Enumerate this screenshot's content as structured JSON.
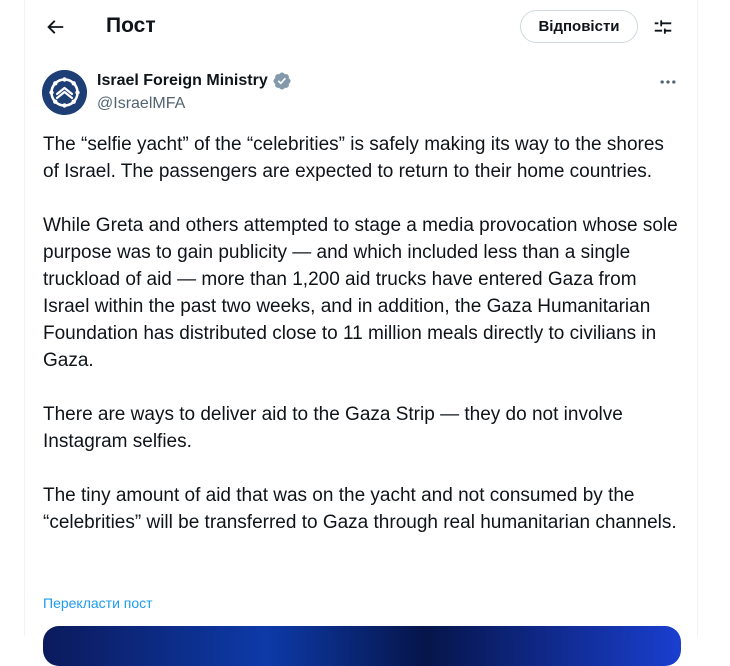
{
  "header": {
    "title": "Пост",
    "reply_label": "Відповісти",
    "back_icon": "arrow-left-icon",
    "settings_icon": "sliders-icon"
  },
  "author": {
    "name": "Israel Foreign Ministry",
    "handle": "@IsraelMFA",
    "verified_icon": "verified-badge-icon",
    "avatar": "israel-mfa-logo",
    "verified_color": "#829aab",
    "avatar_color": "#1e3f75"
  },
  "post": {
    "paragraphs": [
      "The “selfie yacht” of the “celebrities” is safely making its way to the shores of Israel. The passengers are expected to return to their home countries.",
      "While Greta and others attempted to stage a media provocation whose sole purpose was to gain publicity — and which included less than a single truckload of aid — more than 1,200 aid trucks have entered Gaza from Israel within the past two weeks, and in addition, the Gaza Humanitarian Foundation has distributed close to 11 million meals directly to civilians in Gaza.",
      "There are ways to deliver aid to the Gaza Strip — they do not involve Instagram selfies.",
      "The tiny amount of aid that was on the yacht and not consumed by the “celebrities” will be transferred to Gaza through real humanitarian channels."
    ],
    "translate_label": "Перекласти пост",
    "more_icon": "more-dots-icon"
  },
  "colors": {
    "link": "#1d9bf0",
    "secondary_text": "#536471",
    "border": "#cfd9de"
  }
}
